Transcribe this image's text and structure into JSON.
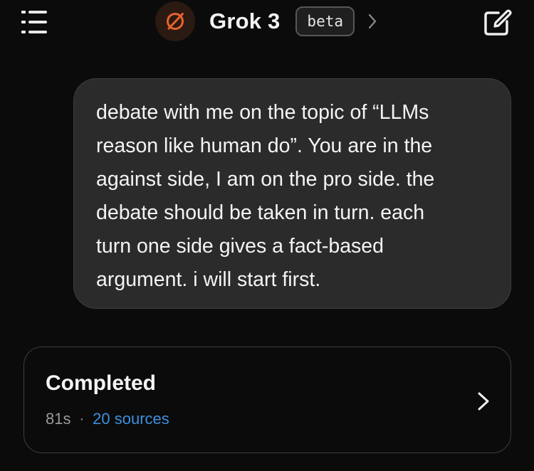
{
  "header": {
    "model_name": "Grok 3",
    "badge": "beta",
    "accent_color": "#e8622a",
    "icons": {
      "menu": "menu-list-icon",
      "logo": "grok-logo-icon",
      "chevron": "chevron-right-icon",
      "new_chat": "new-chat-icon"
    }
  },
  "conversation": {
    "user_message": "debate with me on the topic of “LLMs\nreason like human do”. You are in the\nagainst side, I am on the pro side. the\ndebate should be taken in turn. each\nturn one side gives a fact-based\nargument. i will start first."
  },
  "result_card": {
    "status": "Completed",
    "duration": "81s",
    "separator": "·",
    "sources": "20 sources",
    "link_color": "#3d8fe0"
  }
}
